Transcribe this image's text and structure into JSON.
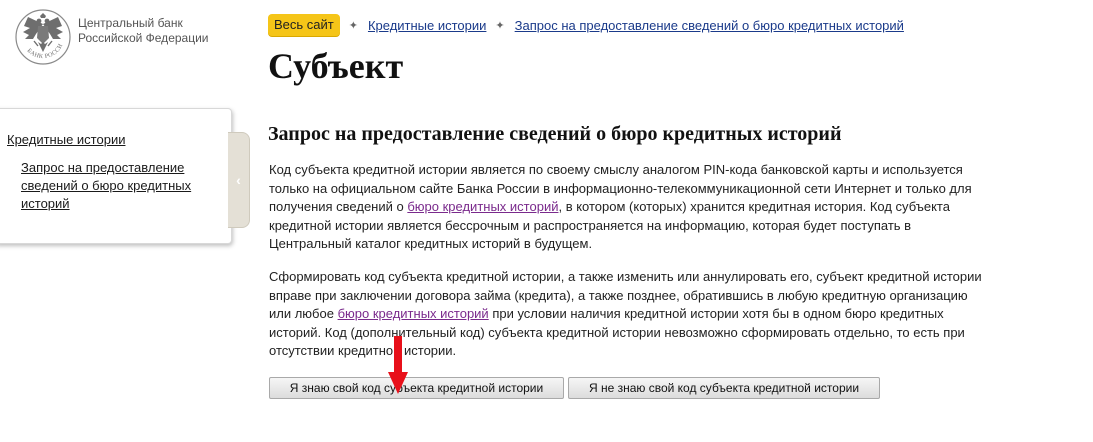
{
  "logo": {
    "emblem_text": "БАНК РОССИИ",
    "line1": "Центральный банк",
    "line2": "Российской Федерации"
  },
  "breadcrumb": {
    "home": "Весь сайт",
    "items": [
      "Кредитные истории",
      "Запрос на предоставление сведений о бюро кредитных историй"
    ],
    "separator": "✦"
  },
  "page_title": "Субъект",
  "sidebar": {
    "item1": "Кредитные истории",
    "item2": "Запрос на предоставление сведений о бюро кредитных историй",
    "toggle_icon": "chevron-left"
  },
  "section_title": "Запрос на предоставление сведений о бюро кредитных историй",
  "paragraph1": {
    "before_link": "Код субъекта кредитной истории является по своему смыслу аналогом PIN-кода банковской карты и используется только на официальном сайте Банка России в информационно-телекоммуникационной сети Интернет и только для получения сведений о ",
    "link": "бюро кредитных историй",
    "after_link": ", в котором (которых) хранится кредитная история. Код субъекта кредитной истории является бессрочным и распространяется на информацию, которая будет поступать в Центральный каталог кредитных историй в будущем."
  },
  "paragraph2": {
    "before_link": "Сформировать код субъекта кредитной истории, а также изменить или аннулировать его, субъект кредитной истории вправе при заключении договора займа (кредита), а также позднее, обратившись в любую кредитную организацию или любое ",
    "link": "бюро кредитных историй",
    "after_link": " при условии наличия кредитной истории хотя бы в одном бюро кредитных историй. Код (дополнительный код) субъекта кредитной истории невозможно сформировать отдельно, то есть при отсутствии кредитной истории."
  },
  "buttons": {
    "know": "Я знаю свой код субъекта кредитной истории",
    "dont_know": "Я не знаю свой код субъекта кредитной истории"
  },
  "colors": {
    "home_badge": "#f5c518",
    "visited_link": "#7a2a8c",
    "annotation_arrow": "#e8101a"
  }
}
